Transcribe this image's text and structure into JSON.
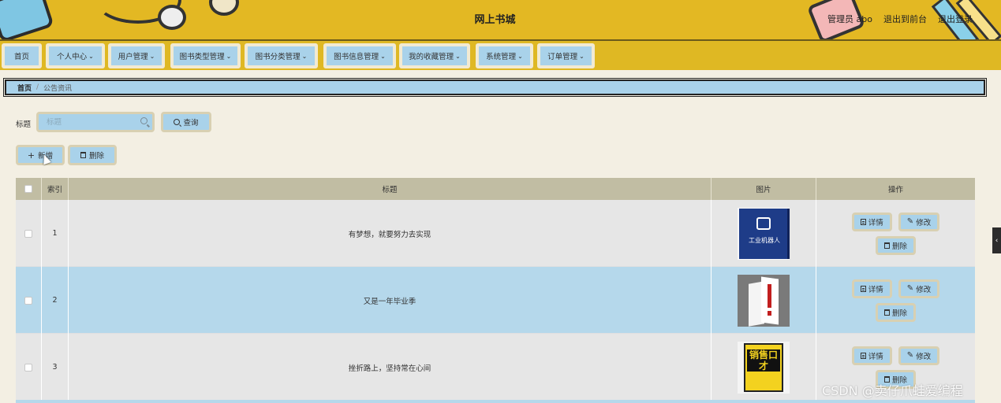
{
  "header": {
    "title": "网上书城",
    "user_label": "管理员 abo",
    "back_to_front": "退出到前台",
    "logout": "退出登录"
  },
  "nav": {
    "items": [
      {
        "label": "首页",
        "has_dropdown": false
      },
      {
        "label": "个人中心",
        "has_dropdown": true
      },
      {
        "label": "用户管理",
        "has_dropdown": true
      },
      {
        "label": "图书类型管理",
        "has_dropdown": true
      },
      {
        "label": "图书分类管理",
        "has_dropdown": true
      },
      {
        "label": "图书信息管理",
        "has_dropdown": true
      },
      {
        "label": "我的收藏管理",
        "has_dropdown": true
      },
      {
        "label": "系统管理",
        "has_dropdown": true
      },
      {
        "label": "订单管理",
        "has_dropdown": true
      }
    ]
  },
  "breadcrumb": {
    "home": "首页",
    "separator": "/",
    "current": "公告资讯"
  },
  "search": {
    "label": "标题",
    "placeholder": "标题",
    "button": "查询"
  },
  "toolbar": {
    "add": "新增",
    "delete": "删除"
  },
  "table": {
    "headers": [
      "索引",
      "标题",
      "图片",
      "操作"
    ],
    "rows": [
      {
        "index": "1",
        "title": "有梦想，就要努力去实现",
        "image": "book-cover-industrial-robot",
        "image_text": "工业机器人"
      },
      {
        "index": "2",
        "title": "又是一年毕业季",
        "image": "book-cover-exclamation"
      },
      {
        "index": "3",
        "title": "挫折路上，坚持常在心间",
        "image": "book-cover-sales",
        "image_text": "销售口才"
      }
    ],
    "actions": {
      "detail": "详情",
      "edit": "修改",
      "delete": "删除"
    }
  },
  "side_handle": "‹",
  "watermark": "CSDN @卖仔爪蛙爱编程",
  "colors": {
    "header_bg": "#e3b823",
    "button_bg": "#a9d2ea",
    "button_border": "#d8d0b2",
    "table_header_bg": "#c1bda3",
    "row_gray": "#e6e6e6",
    "row_blue": "#b5d8eb",
    "page_bg": "#f3efe3"
  }
}
